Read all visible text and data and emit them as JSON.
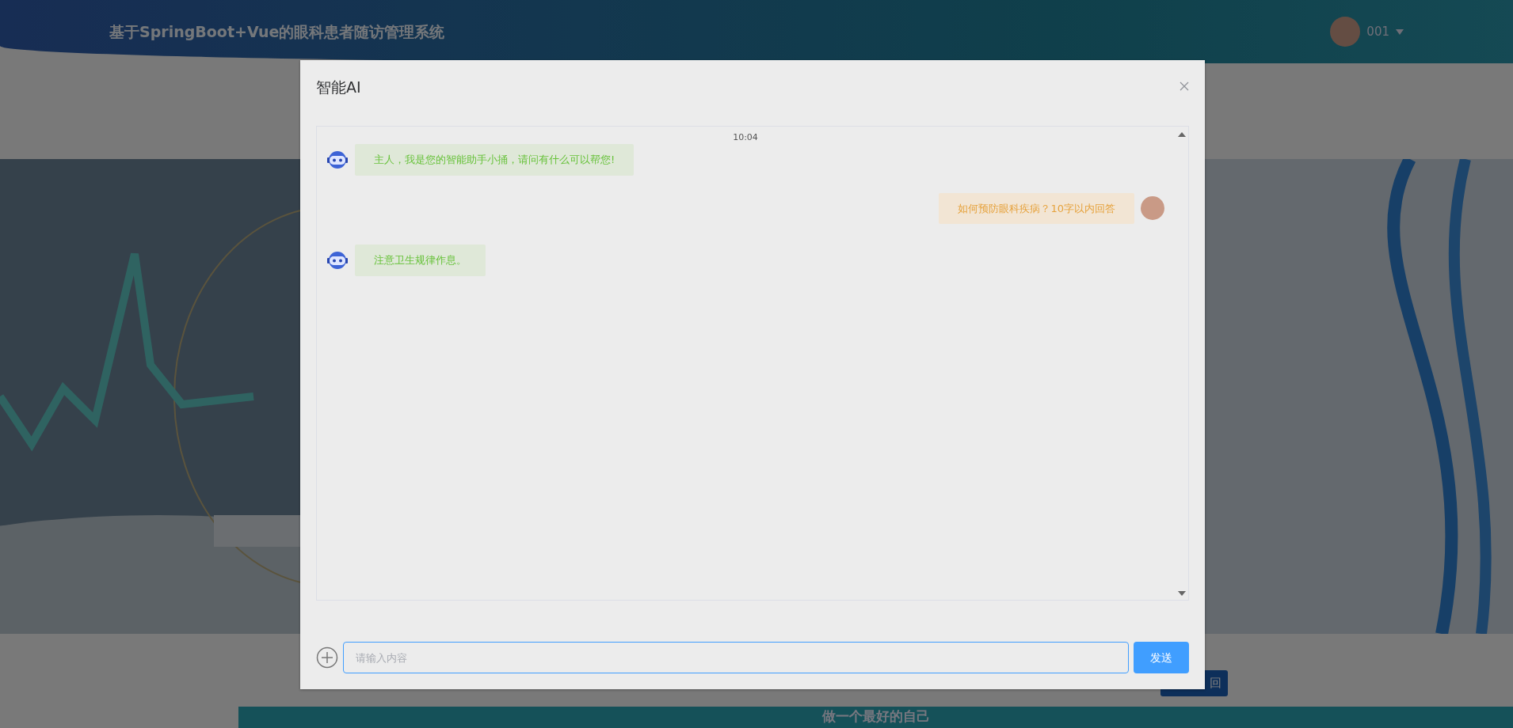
{
  "header": {
    "title": "基于SpringBoot+Vue的眼科患者随访管理系统",
    "user": "001"
  },
  "back_button": {
    "label": "回"
  },
  "footer_bar": {
    "text": "做一个最好的自己"
  },
  "dialog": {
    "title": "智能AI",
    "messages": [
      {
        "kind": "time",
        "text": "10:04"
      },
      {
        "kind": "bot",
        "text": "主人，我是您的智能助手小捅，请问有什么可以帮您!"
      },
      {
        "kind": "user",
        "text": "如何预防眼科疾病？10字以内回答"
      },
      {
        "kind": "bot",
        "text": "注意卫生规律作息。"
      }
    ],
    "input": {
      "placeholder": "请输入内容"
    },
    "send_button": "发送"
  }
}
